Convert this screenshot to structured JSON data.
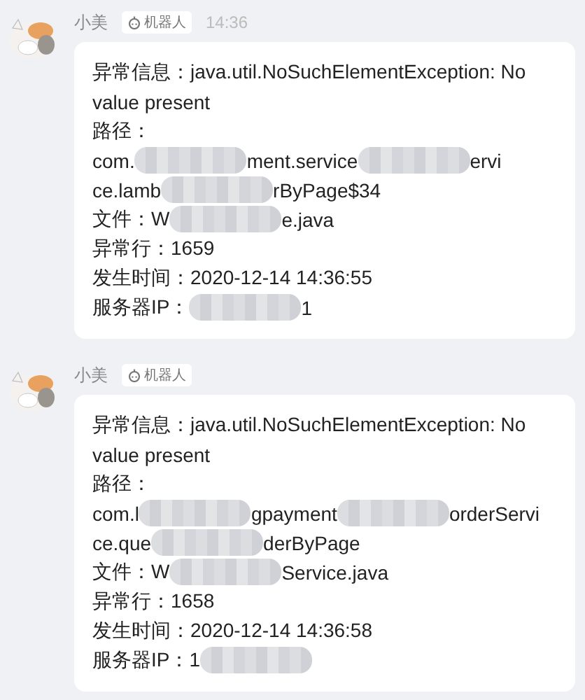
{
  "messages": [
    {
      "sender": "小美",
      "badge": "机器人",
      "time": "14:36",
      "lines": [
        [
          {
            "kind": "text",
            "text": "异常信息：java.util.NoSuchElementException: No"
          }
        ],
        [
          {
            "kind": "text",
            "text": "value present"
          }
        ],
        [
          {
            "kind": "text",
            "text": "路径："
          }
        ],
        [
          {
            "kind": "text",
            "text": "com."
          },
          {
            "kind": "redacted"
          },
          {
            "kind": "text",
            "text": "ment.service"
          },
          {
            "kind": "redacted"
          },
          {
            "kind": "text",
            "text": "ervi"
          }
        ],
        [
          {
            "kind": "text",
            "text": "ce.lamb"
          },
          {
            "kind": "redacted"
          },
          {
            "kind": "text",
            "text": "rByPage$34"
          }
        ],
        [
          {
            "kind": "text",
            "text": "文件：W"
          },
          {
            "kind": "redacted"
          },
          {
            "kind": "text",
            "text": "e.java"
          }
        ],
        [
          {
            "kind": "text",
            "text": "异常行：1659"
          }
        ],
        [
          {
            "kind": "text",
            "text": "发生时间：2020-12-14 14:36:55"
          }
        ],
        [
          {
            "kind": "text",
            "text": "服务器IP："
          },
          {
            "kind": "redacted"
          },
          {
            "kind": "text",
            "text": "1"
          }
        ]
      ]
    },
    {
      "sender": "小美",
      "badge": "机器人",
      "lines": [
        [
          {
            "kind": "text",
            "text": "异常信息：java.util.NoSuchElementException: No"
          }
        ],
        [
          {
            "kind": "text",
            "text": "value present"
          }
        ],
        [
          {
            "kind": "text",
            "text": "路径："
          }
        ],
        [
          {
            "kind": "text",
            "text": "com.l"
          },
          {
            "kind": "redacted"
          },
          {
            "kind": "text",
            "text": "gpayment"
          },
          {
            "kind": "redacted"
          },
          {
            "kind": "text",
            "text": "orderServi"
          }
        ],
        [
          {
            "kind": "text",
            "text": "ce.que"
          },
          {
            "kind": "redacted"
          },
          {
            "kind": "text",
            "text": "derByPage"
          }
        ],
        [
          {
            "kind": "text",
            "text": "文件：W"
          },
          {
            "kind": "redacted"
          },
          {
            "kind": "text",
            "text": "Service.java"
          }
        ],
        [
          {
            "kind": "text",
            "text": "异常行：1658"
          }
        ],
        [
          {
            "kind": "text",
            "text": "发生时间：2020-12-14 14:36:58"
          }
        ],
        [
          {
            "kind": "text",
            "text": "服务器IP：1"
          },
          {
            "kind": "redacted"
          }
        ]
      ]
    }
  ]
}
